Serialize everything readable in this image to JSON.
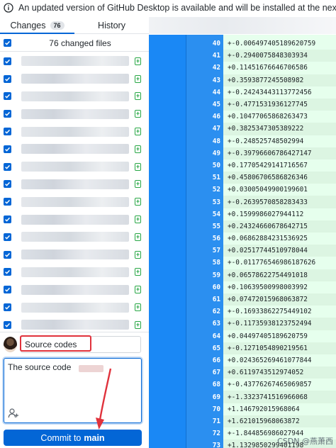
{
  "banner": {
    "icon": "info-icon",
    "text": "An updated version of GitHub Desktop is available and will be installed at the next launch."
  },
  "tabs": [
    {
      "label": "Changes",
      "count": "76",
      "active": true
    },
    {
      "label": "History",
      "active": false
    }
  ],
  "changes": {
    "header_label": "76 changed files",
    "file_count_visible": 16
  },
  "commit": {
    "summary_value": "Source codes",
    "description_value": "The source code",
    "coauthor_icon": "add-coauthor-icon",
    "button_prefix": "Commit to",
    "button_branch": "main"
  },
  "diff": {
    "lines": [
      {
        "n": "40",
        "code": "+-0.006497405189620759"
      },
      {
        "n": "41",
        "code": "+-0.2940075848303934"
      },
      {
        "n": "42",
        "code": "+0.11451676646706586"
      },
      {
        "n": "43",
        "code": "+0.3593877245508982"
      },
      {
        "n": "44",
        "code": "+-0.24243443113772456"
      },
      {
        "n": "45",
        "code": "+-0.4771531936127745"
      },
      {
        "n": "46",
        "code": "+0.10477065868263473"
      },
      {
        "n": "47",
        "code": "+0.3825347305389222"
      },
      {
        "n": "48",
        "code": "+-0.248525748502994"
      },
      {
        "n": "49",
        "code": "+-0.39796606786427147"
      },
      {
        "n": "50",
        "code": "+0.17705429141716567"
      },
      {
        "n": "51",
        "code": "+0.45806706586826346"
      },
      {
        "n": "52",
        "code": "+0.03005049900199601"
      },
      {
        "n": "53",
        "code": "+-0.2639570858283433"
      },
      {
        "n": "54",
        "code": "+0.1599986027944112"
      },
      {
        "n": "55",
        "code": "+0.24324660678642715"
      },
      {
        "n": "56",
        "code": "+0.06862884231536925"
      },
      {
        "n": "57",
        "code": "+0.02517744510978044"
      },
      {
        "n": "58",
        "code": "+-0.011776546986187626"
      },
      {
        "n": "59",
        "code": "+0.06578622754491018"
      },
      {
        "n": "60",
        "code": "+0.10639500998003992"
      },
      {
        "n": "61",
        "code": "+0.07472015968063872"
      },
      {
        "n": "62",
        "code": "+-0.16933862275449102"
      },
      {
        "n": "63",
        "code": "+-0.11735938123752494"
      },
      {
        "n": "64",
        "code": "+0.04497405189620759"
      },
      {
        "n": "65",
        "code": "+-0.1271054890219561"
      },
      {
        "n": "66",
        "code": "+0.024365269461077844"
      },
      {
        "n": "67",
        "code": "+0.6119743512974052"
      },
      {
        "n": "68",
        "code": "+-0.43776267465069857"
      },
      {
        "n": "69",
        "code": "+-1.3323741516966068"
      },
      {
        "n": "70",
        "code": "+1.146792015968064"
      },
      {
        "n": "71",
        "code": "+1.621015968063872"
      },
      {
        "n": "72",
        "code": "+-1.844856986027944"
      },
      {
        "n": "73",
        "code": "+1.1329850299401198"
      }
    ]
  },
  "watermark": "CSDN @燕萧西",
  "colors": {
    "accent": "#0366d6",
    "added": "#28a745",
    "highlight": "#e0323c",
    "gutter": "#1a88f5"
  }
}
